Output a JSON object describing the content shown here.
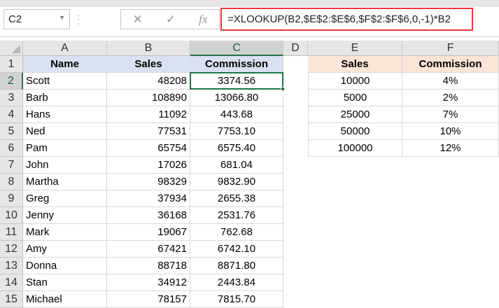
{
  "name_box": "C2",
  "formula_bar": {
    "cancel_icon": "✕",
    "enter_icon": "✓",
    "fx_label": "fx",
    "formula": "=XLOOKUP(B2,$E$2:$E$6,$F$2:$F$6,0,-1)*B2"
  },
  "columns": [
    "A",
    "B",
    "C",
    "D",
    "E",
    "F"
  ],
  "rows": [
    "1",
    "2",
    "3",
    "4",
    "5",
    "6",
    "7",
    "8",
    "9",
    "10",
    "11",
    "12",
    "13",
    "14",
    "15"
  ],
  "main_table": {
    "headers": [
      "Name",
      "Sales",
      "Commission"
    ],
    "rows": [
      [
        "Scott",
        "48208",
        "3374.56"
      ],
      [
        "Barb",
        "108890",
        "13066.80"
      ],
      [
        "Hans",
        "11092",
        "443.68"
      ],
      [
        "Ned",
        "77531",
        "7753.10"
      ],
      [
        "Pam",
        "65754",
        "6575.40"
      ],
      [
        "John",
        "17026",
        "681.04"
      ],
      [
        "Martha",
        "98329",
        "9832.90"
      ],
      [
        "Greg",
        "37934",
        "2655.38"
      ],
      [
        "Jenny",
        "36168",
        "2531.76"
      ],
      [
        "Mark",
        "19067",
        "762.68"
      ],
      [
        "Amy",
        "67421",
        "6742.10"
      ],
      [
        "Donna",
        "88718",
        "8871.80"
      ],
      [
        "Stan",
        "34912",
        "2443.84"
      ],
      [
        "Michael",
        "78157",
        "7815.70"
      ]
    ]
  },
  "lookup_table": {
    "headers": [
      "Sales",
      "Commission"
    ],
    "rows": [
      [
        "10000",
        "4%"
      ],
      [
        "5000",
        "2%"
      ],
      [
        "25000",
        "7%"
      ],
      [
        "50000",
        "10%"
      ],
      [
        "100000",
        "12%"
      ]
    ]
  },
  "colors": {
    "accent": "#217346",
    "formula_highlight": "#e8383f",
    "header_blue": "#d9e1f2",
    "header_orange": "#fce4d6"
  }
}
